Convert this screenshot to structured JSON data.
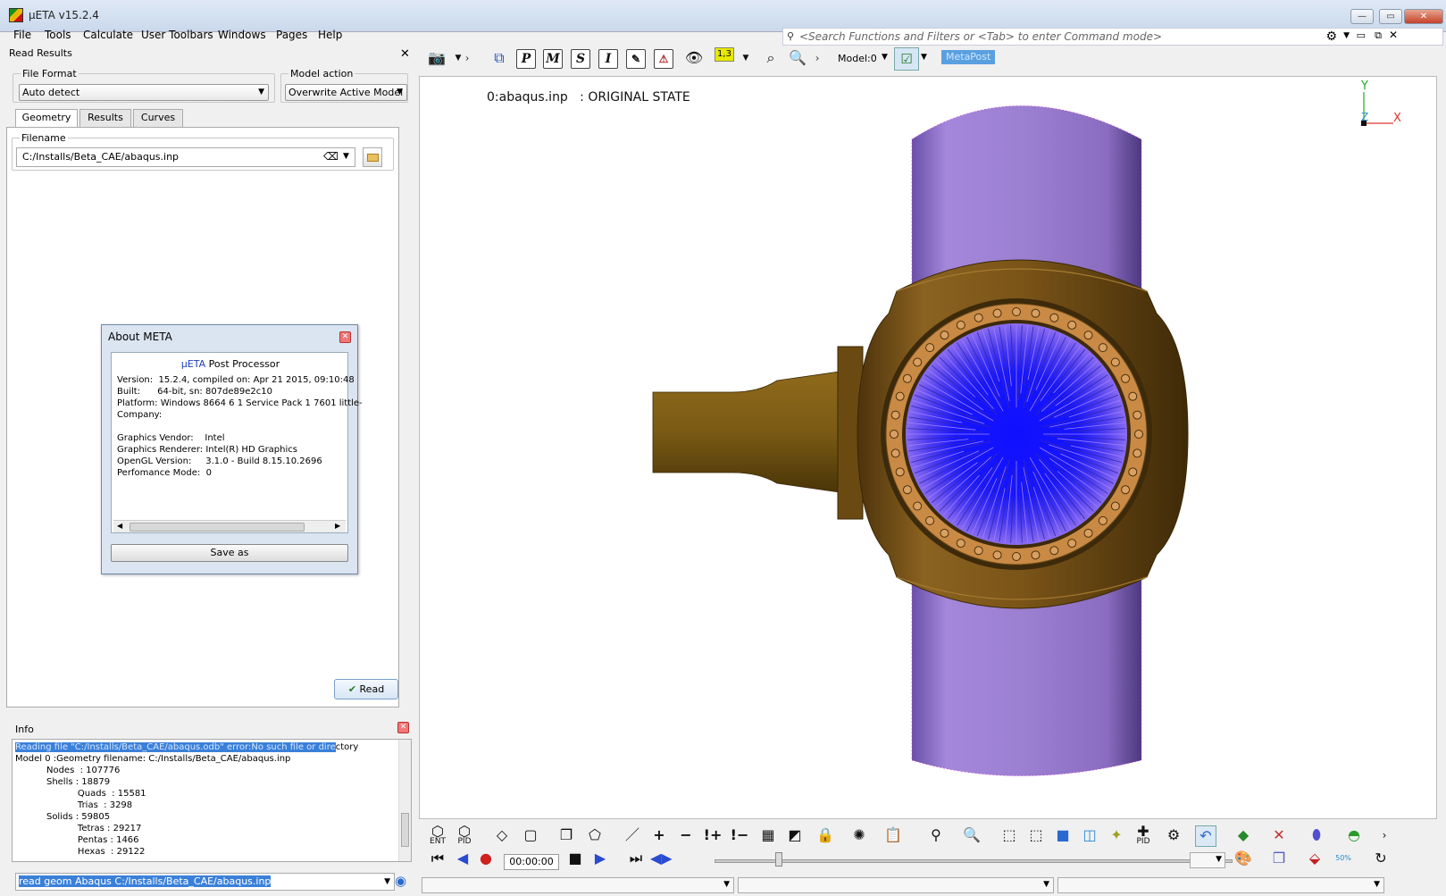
{
  "window": {
    "title": "μETA v15.2.4"
  },
  "menu": [
    "File",
    "Tools",
    "Calculate",
    "User Toolbars",
    "Windows",
    "Pages",
    "Help"
  ],
  "search": {
    "placeholder": "<Search Functions and Filters or <Tab> to enter Command mode>"
  },
  "read_panel": {
    "title": "Read Results",
    "file_format_label": "File Format",
    "file_format_value": "Auto detect",
    "model_action_label": "Model action",
    "model_action_value": "Overwrite Active Model",
    "tabs": [
      "Geometry",
      "Results",
      "Curves"
    ],
    "filename_label": "Filename",
    "filename_value": "C:/Installs/Beta_CAE/abaqus.inp",
    "read_button": "Read"
  },
  "about": {
    "title": "About META",
    "heading_brand": "μETA",
    "heading_rest": " Post Processor",
    "text": "Version:  15.2.4, compiled on: Apr 21 2015, 09:10:48\nBuilt:      64-bit, sn: 807de89e2c10\nPlatform: Windows 8664 6 1 Service Pack 1 7601 little-\nCompany:\n\nGraphics Vendor:    Intel\nGraphics Renderer: Intel(R) HD Graphics\nOpenGL Version:     3.1.0 - Build 8.15.10.2696\nPerfomance Mode:  0",
    "save_button": "Save as"
  },
  "info": {
    "title": "Info",
    "highlight_line": "Reading file \"C:/Installs/Beta_CAE/abaqus.odb\" error:No such file or dire",
    "highlight_tail": "ctory",
    "lines": "Model 0 :Geometry filename: C:/Installs/Beta_CAE/abaqus.inp\n           Nodes  : 107776\n           Shells : 18879\n                      Quads  : 15581\n                      Trias  : 3298\n           Solids : 59805\n                      Tetras : 29217\n                      Pentas : 1466\n                      Hexas  : 29122"
  },
  "command": {
    "value": "read geom Abaqus C:/Installs/Beta_CAE/abaqus.inp"
  },
  "toolbar": {
    "model_label": "Model:0",
    "metapost_label": "MetaPost",
    "ratio_label": "1,3"
  },
  "viewport": {
    "label": "0:abaqus.inp   : ORIGINAL STATE",
    "axis_y": "Y",
    "axis_x": "X",
    "axis_z": "Z"
  },
  "playback": {
    "time": "00:00:00",
    "ent_label": "ENT",
    "pid_label": "PID",
    "pid2_label": "PID",
    "zoom_label": "50%"
  },
  "colors": {
    "pipe": "#9b7fd1",
    "body": "#7a5418",
    "flange": "#c98a45",
    "mesh": "#1010ff"
  }
}
